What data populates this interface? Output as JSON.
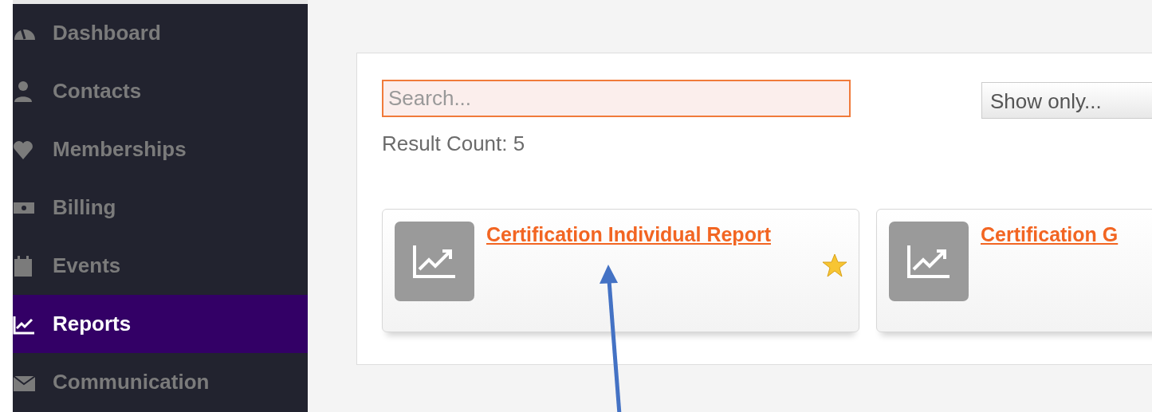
{
  "sidebar": {
    "items": [
      {
        "label": "Dashboard",
        "selected": false
      },
      {
        "label": "Contacts",
        "selected": false
      },
      {
        "label": "Memberships",
        "selected": false
      },
      {
        "label": "Billing",
        "selected": false
      },
      {
        "label": "Events",
        "selected": false
      },
      {
        "label": "Reports",
        "selected": true
      },
      {
        "label": "Communication",
        "selected": false
      }
    ]
  },
  "search": {
    "placeholder": "Search..."
  },
  "filter": {
    "value": "Show only..."
  },
  "result_count": "Result Count: 5",
  "reports": [
    {
      "title": "Certification Individual Report",
      "favorite": true
    },
    {
      "title": "Certification G"
    }
  ]
}
